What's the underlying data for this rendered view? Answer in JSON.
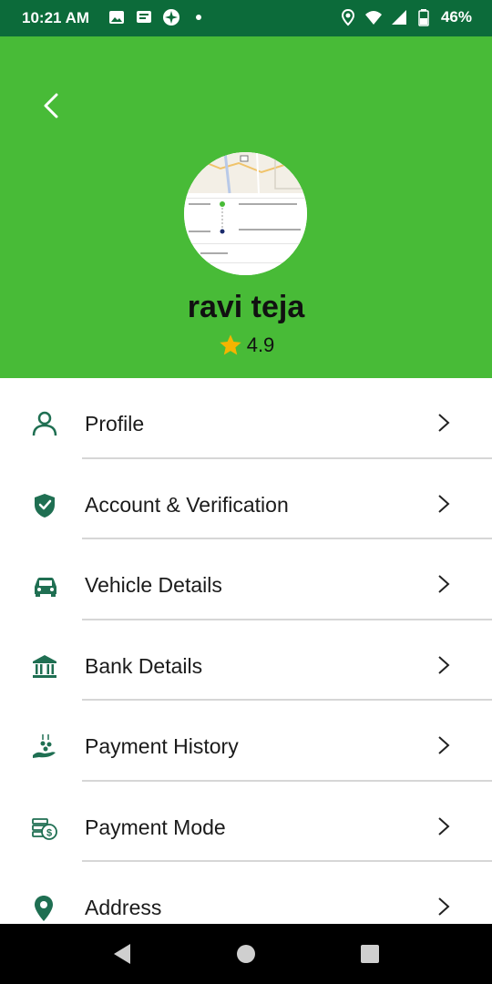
{
  "status_bar": {
    "time": "10:21 AM",
    "battery": "46%",
    "icons": [
      "image-icon",
      "message-icon",
      "compass-icon",
      "dot-icon",
      "location-icon",
      "wifi-icon",
      "signal-icon",
      "battery-icon"
    ]
  },
  "header": {
    "back_icon": "back-chevron-icon",
    "profile_name": "ravi teja",
    "rating": "4.9",
    "background_color": "#48bb37"
  },
  "menu": {
    "items": [
      {
        "label": "Profile",
        "icon": "person-icon"
      },
      {
        "label": "Account & Verification",
        "icon": "shield-check-icon"
      },
      {
        "label": "Vehicle Details",
        "icon": "car-icon"
      },
      {
        "label": "Bank Details",
        "icon": "bank-icon"
      },
      {
        "label": "Payment History",
        "icon": "hand-coins-icon"
      },
      {
        "label": "Payment Mode",
        "icon": "money-stack-icon"
      },
      {
        "label": "Address",
        "icon": "map-pin-icon"
      }
    ],
    "icon_color": "#1f6f52"
  },
  "nav_bar": {
    "buttons": [
      "back-triangle-icon",
      "home-circle-icon",
      "recents-square-icon"
    ]
  }
}
